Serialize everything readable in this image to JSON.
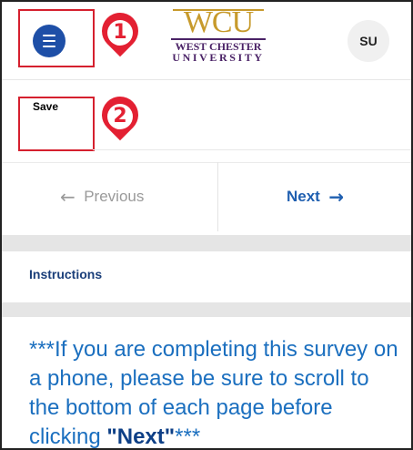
{
  "header": {
    "logo": {
      "mark": "WCU",
      "line1": "WEST CHESTER",
      "line2": "UNIVERSITY"
    },
    "avatar_initials": "SU"
  },
  "callouts": [
    "1",
    "2"
  ],
  "toolbar": {
    "save_label": "Save"
  },
  "pager": {
    "previous_label": "Previous",
    "next_label": "Next",
    "previous_icon": "arrow-left-icon",
    "next_icon": "arrow-right-icon"
  },
  "section": {
    "label": "Instructions"
  },
  "notice": {
    "prefix": "***If you are completing this survey on a phone, please be sure to scroll to the bottom of each page before clicking ",
    "emphasis": "\"Next\"",
    "suffix": "***"
  },
  "colors": {
    "menu_button": "#1e4fa7",
    "callout_red": "#e32032",
    "link_blue": "#1f5fb0",
    "body_blue": "#1b6fbf",
    "section_navy": "#1b3f7a"
  }
}
